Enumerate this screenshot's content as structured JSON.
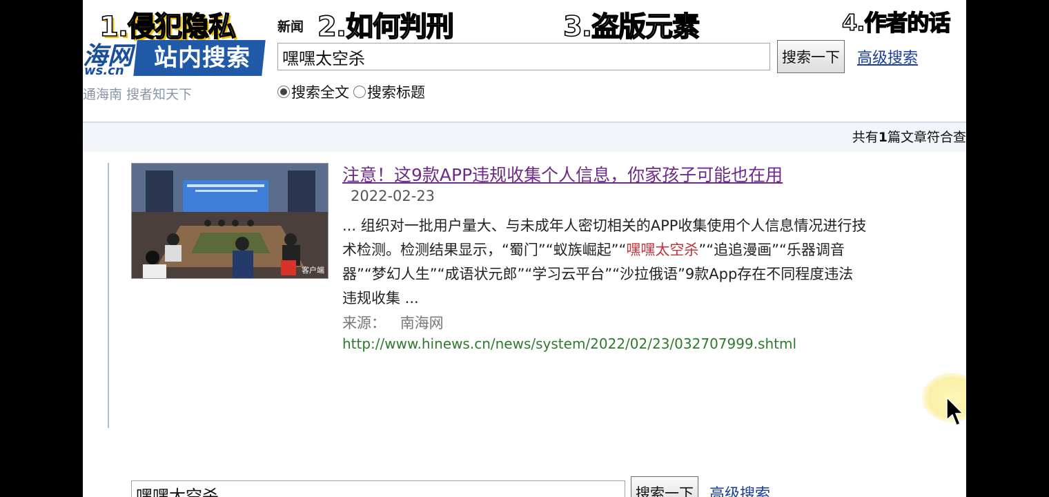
{
  "overlay_captions": [
    "1.侵犯隐私",
    "2.如何判刑",
    "3.盗版元素",
    "4.作者的话"
  ],
  "header": {
    "news_label": "新闻"
  },
  "logo": {
    "brand_partial": "海网",
    "domain_partial": "ws.cn",
    "title": "站内搜索",
    "slogan": "通海南  搜者知天下",
    "brand_color": "#1f59a8"
  },
  "search": {
    "query": "嘿嘿太空杀",
    "button_label": "搜索一下",
    "advanced_label": "高级搜索",
    "options": [
      {
        "label": "搜索全文",
        "selected": true
      },
      {
        "label": "搜索标题",
        "selected": false
      }
    ]
  },
  "results_summary": {
    "prefix": "共有",
    "count": "1",
    "suffix": "篇文章符合查"
  },
  "results": [
    {
      "title": "注意！这9款APP违规收集个人信息，你家孩子可能也在用",
      "date": "2022-02-23",
      "snippet_before": "... 组织对一批用户量大、与未成年人密切相关的APP收集使用个人信息情况进行技术检测。检测结果显示，“蜀门”“蚁族崛起”“",
      "snippet_highlight": "嘿嘿太空杀",
      "snippet_after": "”“追追漫画”“乐器调音器”“梦幻人生”“成语状元郎”“学习云平台”“沙拉俄语”9款App存在不同程度违法违规收集 ...",
      "source_label": "来源：",
      "source_name": "南海网",
      "url": "http://www.hinews.cn/news/system/2022/02/23/032707999.shtml",
      "thumbnail_badge": "客户端"
    }
  ],
  "bottom_search": {
    "query": "嘿嘿太空杀",
    "button_label": "搜索一下",
    "advanced_label": "高级搜索"
  }
}
